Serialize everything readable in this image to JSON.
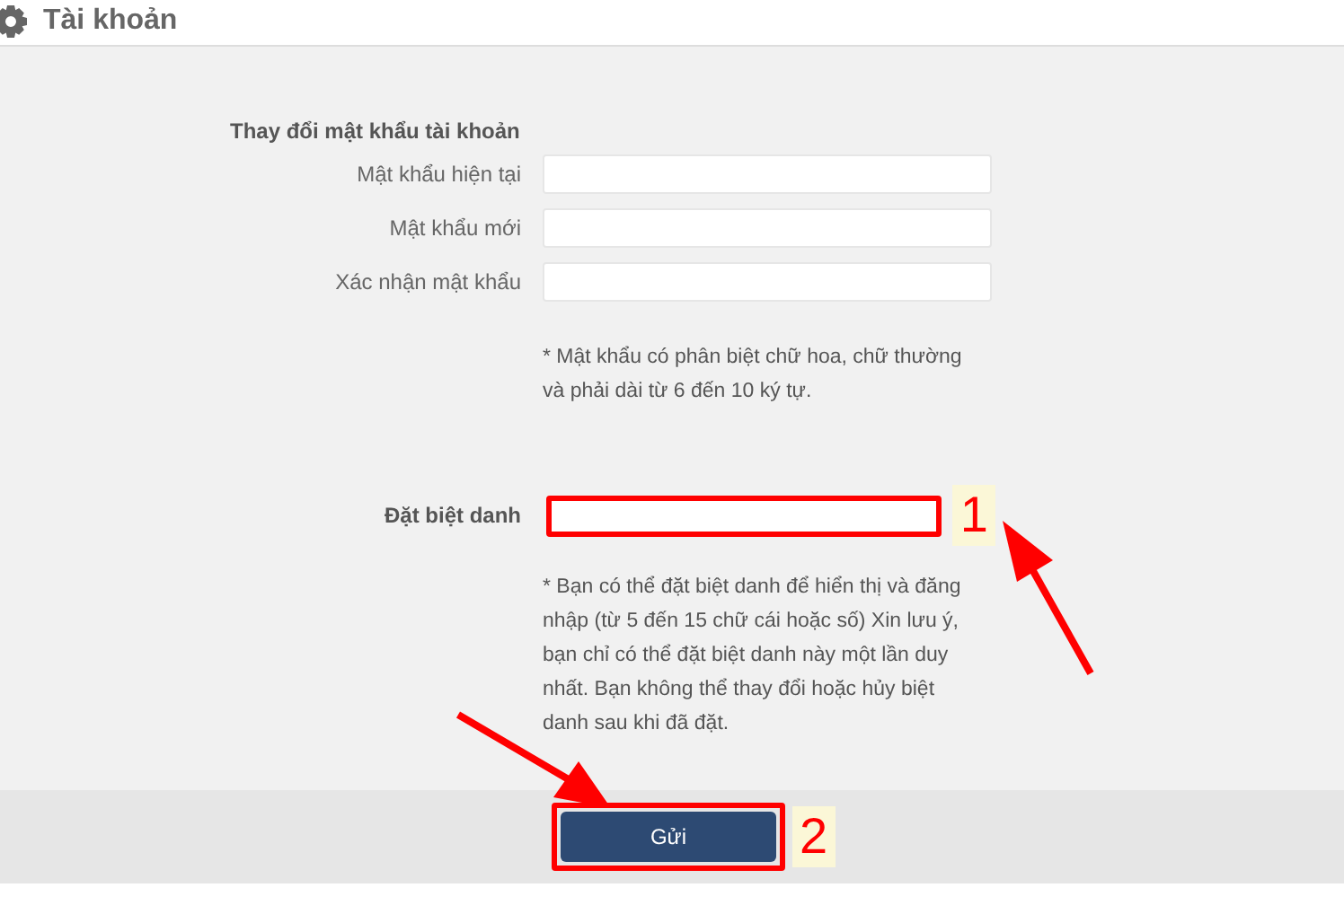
{
  "header": {
    "title": "Tài khoản"
  },
  "password_section": {
    "heading": "Thay đổi mật khẩu tài khoản",
    "fields": [
      {
        "label": "Mật khẩu hiện tại"
      },
      {
        "label": "Mật khẩu mới"
      },
      {
        "label": "Xác nhận mật khẩu"
      }
    ],
    "note": "* Mật khẩu có phân biệt chữ hoa, chữ thường và phải dài từ 6 đến 10 ký tự."
  },
  "nickname": {
    "label": "Đặt biệt danh",
    "highlighted": true,
    "callout": "1",
    "note": "* Bạn có thể đặt biệt danh để hiển thị và đăng nhập (từ 5 đến 15 chữ cái hoặc số) Xin lưu ý, bạn chỉ có thể đặt biệt danh này một lần duy nhất. Bạn không thể thay đổi hoặc hủy biệt danh sau khi đã đặt."
  },
  "submit": {
    "label": "Gửi",
    "highlighted": true,
    "callout": "2"
  }
}
